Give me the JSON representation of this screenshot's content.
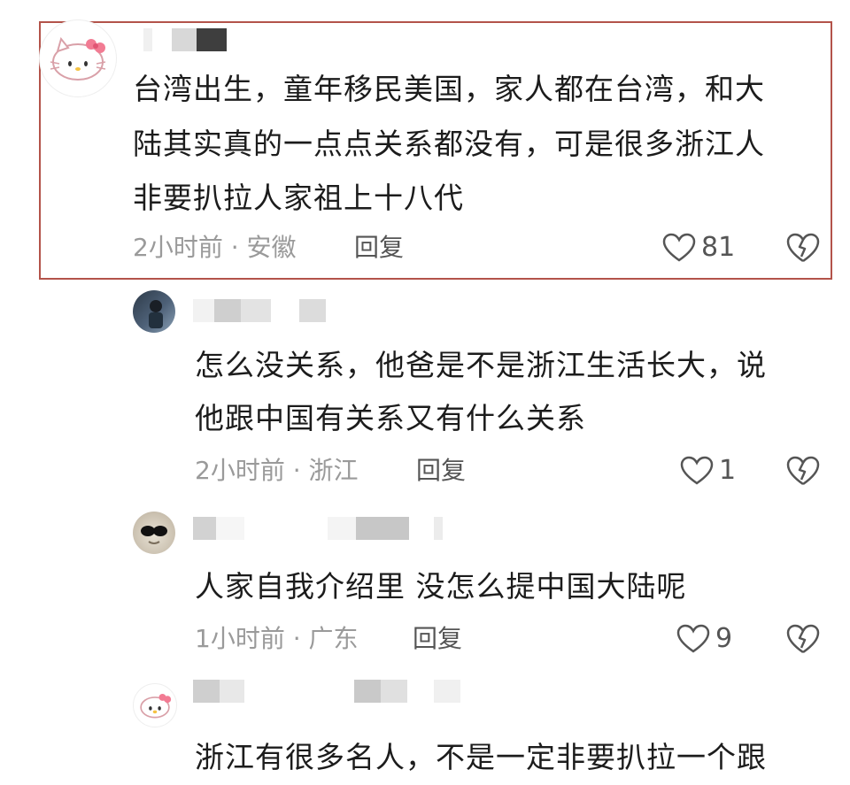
{
  "comments": [
    {
      "text_lines": [
        "台湾出生，童年移民美国，家人都在台湾，和大",
        "陆其实真的一点点关系都没有，可是很多浙江人",
        "非要扒拉人家祖上十八代"
      ],
      "meta": "2小时前 · 安徽",
      "reply_label": "回复",
      "likes": "81",
      "avatar_icon": "hello-kitty-icon"
    },
    {
      "text_lines": [
        "怎么没关系，他爸是不是浙江生活长大，说",
        "他跟中国有关系又有什么关系"
      ],
      "meta": "2小时前 · 浙江",
      "reply_label": "回复",
      "likes": "1",
      "avatar_icon": "photo-avatar"
    },
    {
      "text_lines": [
        "人家自我介绍里 没怎么提中国大陆呢"
      ],
      "meta": "1小时前 · 广东",
      "reply_label": "回复",
      "likes": "9",
      "avatar_icon": "sunglasses-avatar"
    },
    {
      "text_lines": [
        "浙江有很多名人，不是一定非要扒拉一个跟"
      ],
      "avatar_icon": "hello-kitty-icon"
    }
  ],
  "colors": {
    "highlight_border": "#b3534a",
    "meta_gray": "#9a9a9a"
  }
}
